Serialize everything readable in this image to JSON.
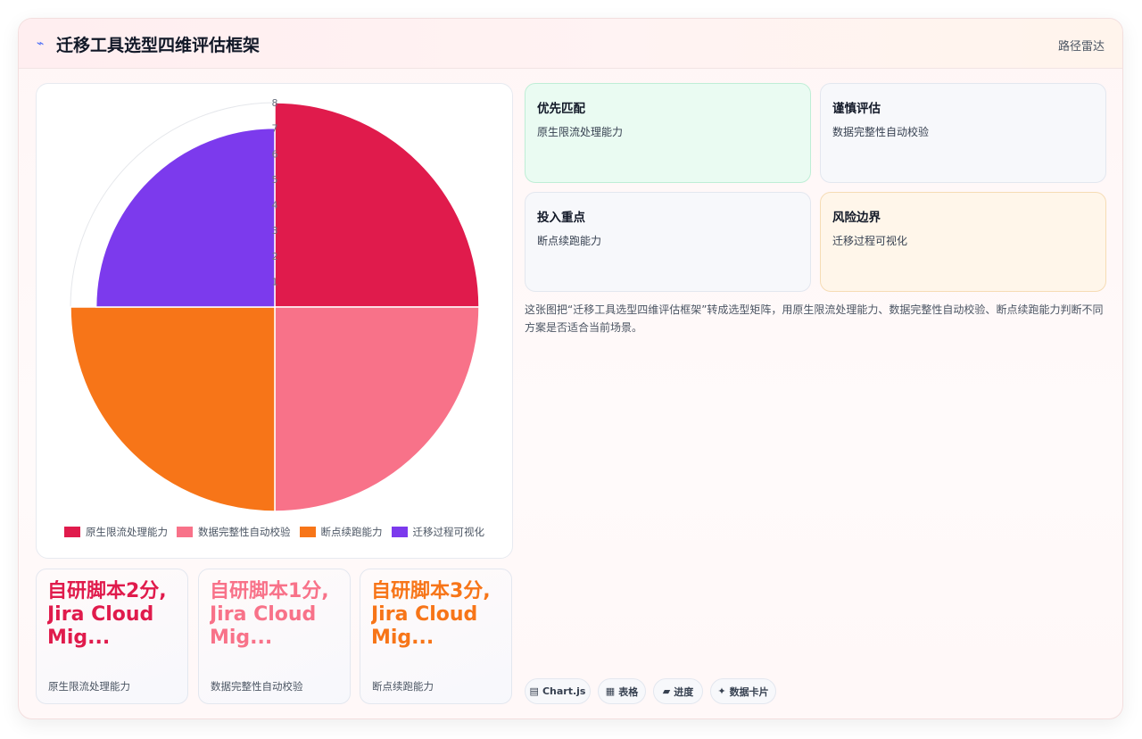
{
  "header": {
    "icon": "lightning-icon",
    "icon_glyph": "⌁",
    "title": "迁移工具选型四维评估框架",
    "right_label": "路径雷达"
  },
  "chart_data": {
    "type": "polarArea",
    "categories": [
      "原生限流处理能力",
      "数据完整性自动校验",
      "断点续跑能力",
      "迁移过程可视化"
    ],
    "values": [
      8,
      8,
      8,
      7
    ],
    "colors": [
      "#e01b4c",
      "#f87289",
      "#f77518",
      "#7c3aed"
    ],
    "r_ticks": [
      "1",
      "2",
      "3",
      "4",
      "5",
      "6",
      "7",
      "8"
    ],
    "r_max": 8,
    "legend_position": "bottom"
  },
  "kpis": [
    {
      "value": "自研脚本2分, Jira Cloud Mig...",
      "label": "原生限流处理能力",
      "color": "#e01b4c"
    },
    {
      "value": "自研脚本1分, Jira Cloud Mig...",
      "label": "数据完整性自动校验",
      "color": "#f87289"
    },
    {
      "value": "自研脚本3分, Jira Cloud Mig...",
      "label": "断点续跑能力",
      "color": "#f77518"
    }
  ],
  "tiles": [
    {
      "title": "优先匹配",
      "detail": "原生限流处理能力",
      "bg": "#eafbf2",
      "border": "#bfeed6"
    },
    {
      "title": "谨慎评估",
      "detail": "数据完整性自动校验",
      "bg": "#f7f8fb",
      "border": "#e3e7ef"
    },
    {
      "title": "投入重点",
      "detail": "断点续跑能力",
      "bg": "#f7f8fb",
      "border": "#e3e7ef"
    },
    {
      "title": "风险边界",
      "detail": "迁移过程可视化",
      "bg": "#fff6ea",
      "border": "#f6dcb5"
    }
  ],
  "description": "这张图把“迁移工具选型四维评估框架”转成选型矩阵，用原生限流处理能力、数据完整性自动校验、断点续跑能力判断不同方案是否适合当前场景。",
  "tags": [
    {
      "glyph": "▤",
      "label": "Chart.js",
      "icon": "chart-icon"
    },
    {
      "glyph": "▦",
      "label": "表格",
      "icon": "table-icon"
    },
    {
      "glyph": "▰",
      "label": "进度",
      "icon": "progress-icon"
    },
    {
      "glyph": "✦",
      "label": "数据卡片",
      "icon": "sparkle-icon"
    }
  ]
}
